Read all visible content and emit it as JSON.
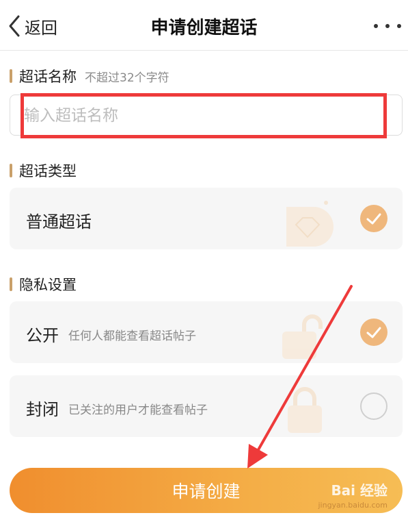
{
  "nav": {
    "back_label": "返回",
    "title": "申请创建超话"
  },
  "name_section": {
    "label": "超话名称",
    "hint": "不超过32个字符",
    "placeholder": "输入超话名称",
    "value": ""
  },
  "type_section": {
    "label": "超话类型",
    "options": [
      {
        "title": "普通超话",
        "selected": true
      }
    ]
  },
  "privacy_section": {
    "label": "隐私设置",
    "options": [
      {
        "title": "公开",
        "desc": "任何人都能查看超话帖子",
        "selected": true
      },
      {
        "title": "封闭",
        "desc": "已关注的用户才能查看帖子",
        "selected": false
      }
    ]
  },
  "submit_label": "申请创建",
  "watermark": {
    "logo": "Bai 经验",
    "sub": "jingyan.baidu.com"
  },
  "colors": {
    "accent": "#efb77c",
    "button_start": "#f08e2e",
    "button_end": "#f6bd55",
    "annotation": "#ee3a3a",
    "section_bar": "#c9a06a"
  }
}
